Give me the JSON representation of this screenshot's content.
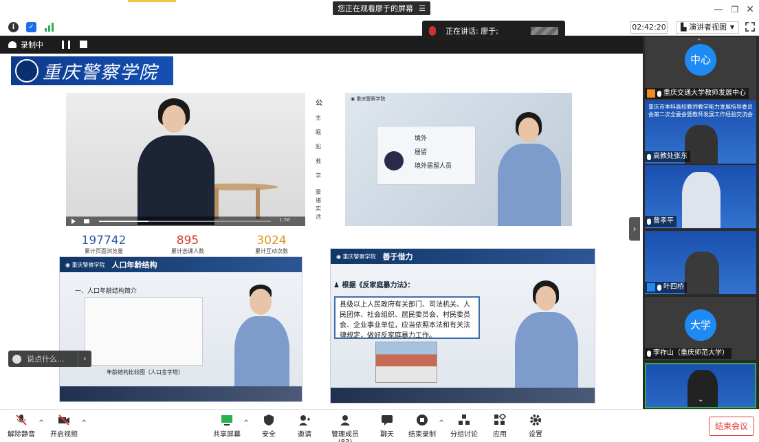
{
  "titlebar": {
    "share_banner": "您正在观看廖于的屏幕",
    "menu_icon": "list-icon"
  },
  "toolbar": {
    "timer": "02:42:20",
    "view_label": "演讲者视图"
  },
  "speaking": {
    "label": "正在讲话: 廖于;"
  },
  "recording": {
    "label": "录制中"
  },
  "share": {
    "logo_text": "重庆警察学院",
    "video1": {
      "time": "1:56"
    },
    "side_chars": [
      "公",
      "主",
      "眠",
      "起",
      "救",
      "学",
      "豪",
      "诸",
      "实",
      "活"
    ],
    "video2": {
      "lines": [
        "境外",
        "居留",
        "境外居留人员"
      ]
    },
    "stats": [
      {
        "num": "197742",
        "label": "累计页面浏览量",
        "color": "#2a5aa8"
      },
      {
        "num": "895",
        "label": "累计选课人数",
        "color": "#d9342b"
      },
      {
        "num": "3024",
        "label": "累计互动次数",
        "color": "#e39219"
      }
    ],
    "slide3": {
      "title": "人口年龄结构",
      "subtitle": "一、人口年龄结构简介",
      "caption": "年龄结构比较图（人口金字塔）"
    },
    "slide4": {
      "title": "善于借力",
      "heading": "根据《反家庭暴力法》：",
      "body": "县级以上人民政府有关部门、司法机关、人民团体、社会组织、居民委员会、村民委员会、企业事业单位，应当依照本法和有关法律规定，做好反家庭暴力工作。"
    },
    "comment_placeholder": "说点什么..."
  },
  "participants": [
    {
      "avatar_text": "中心",
      "name": "重庆交通大学教师发展中心"
    },
    {
      "slide_text": "重庆市本科高校教师教学能力发展指导委员会第二次全委会暨教师发展工作经验交流会",
      "name": "高教处张东"
    },
    {
      "name": "曾孝平"
    },
    {
      "name": "叶四桥"
    },
    {
      "avatar_text": "大学",
      "name": "李祚山（重庆师范大学）"
    },
    {
      "name": ""
    }
  ],
  "bottombar": {
    "unmute": "解除静音",
    "start_video": "开启视频",
    "share_screen": "共享屏幕",
    "security": "安全",
    "invite": "邀请",
    "members": "管理成员(83)",
    "chat": "聊天",
    "end_record": "结束录制",
    "breakout": "分组讨论",
    "apps": "应用",
    "settings": "设置",
    "end_meeting": "结束会议"
  }
}
